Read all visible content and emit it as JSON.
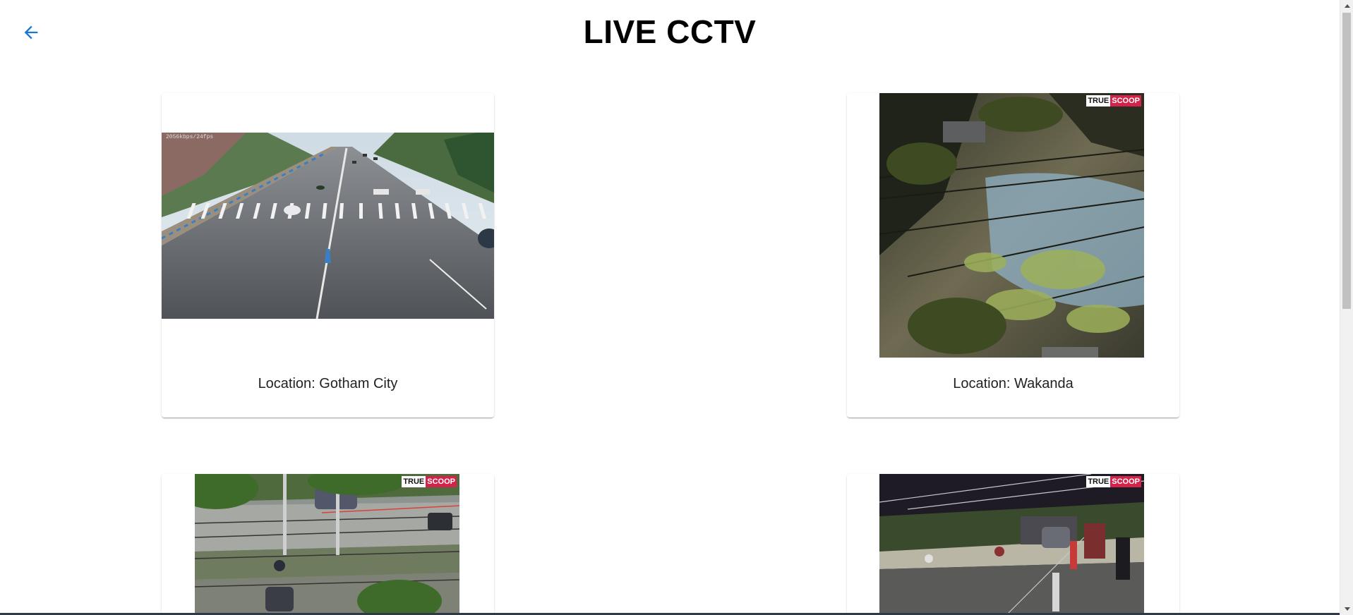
{
  "header": {
    "title": "LIVE CCTV",
    "back_icon": "arrow-left-icon",
    "accent_color": "#1976d2"
  },
  "cameras": [
    {
      "location_label": "Location: Gotham City",
      "feed": "daytime road crosswalk feed"
    },
    {
      "location_label": "Location: Wakanda",
      "feed": "night street feed with trees",
      "watermark": [
        "TRUE",
        "SCOOP"
      ]
    },
    {
      "location_label": "",
      "feed": "daytime roadside feed with scooter",
      "watermark": [
        "TRUE",
        "SCOOP"
      ]
    },
    {
      "location_label": "",
      "feed": "night street feed with pedestrians",
      "watermark": [
        "TRUE",
        "SCOOP"
      ]
    }
  ]
}
